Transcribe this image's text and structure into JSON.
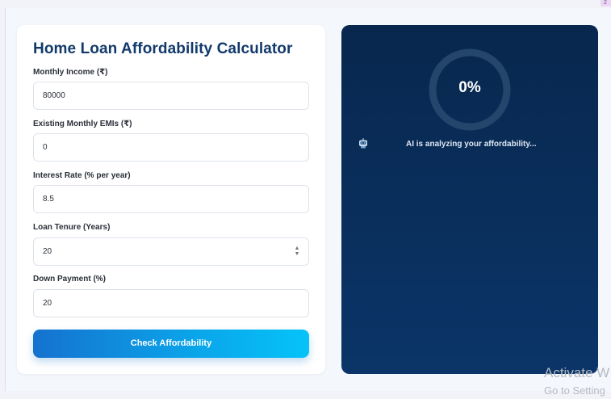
{
  "form": {
    "title": "Home Loan Affordability Calculator",
    "fields": [
      {
        "label": "Monthly Income (₹)",
        "value": "80000"
      },
      {
        "label": "Existing Monthly EMIs (₹)",
        "value": "0"
      },
      {
        "label": "Interest Rate (% per year)",
        "value": "8.5"
      },
      {
        "label": "Loan Tenure (Years)",
        "value": "20"
      },
      {
        "label": "Down Payment (%)",
        "value": "20"
      }
    ],
    "submit_label": "Check Affordability"
  },
  "result": {
    "progress_label": "0%",
    "progress_fraction": 0,
    "status": "AI is analyzing your affordability...",
    "robot_icon": "robot-icon"
  },
  "watermark": {
    "line1": "Activate W",
    "line2": "Go to Setting"
  },
  "colors": {
    "accent": "#1572cf",
    "panel": "#08274e",
    "title": "#123a6b"
  }
}
